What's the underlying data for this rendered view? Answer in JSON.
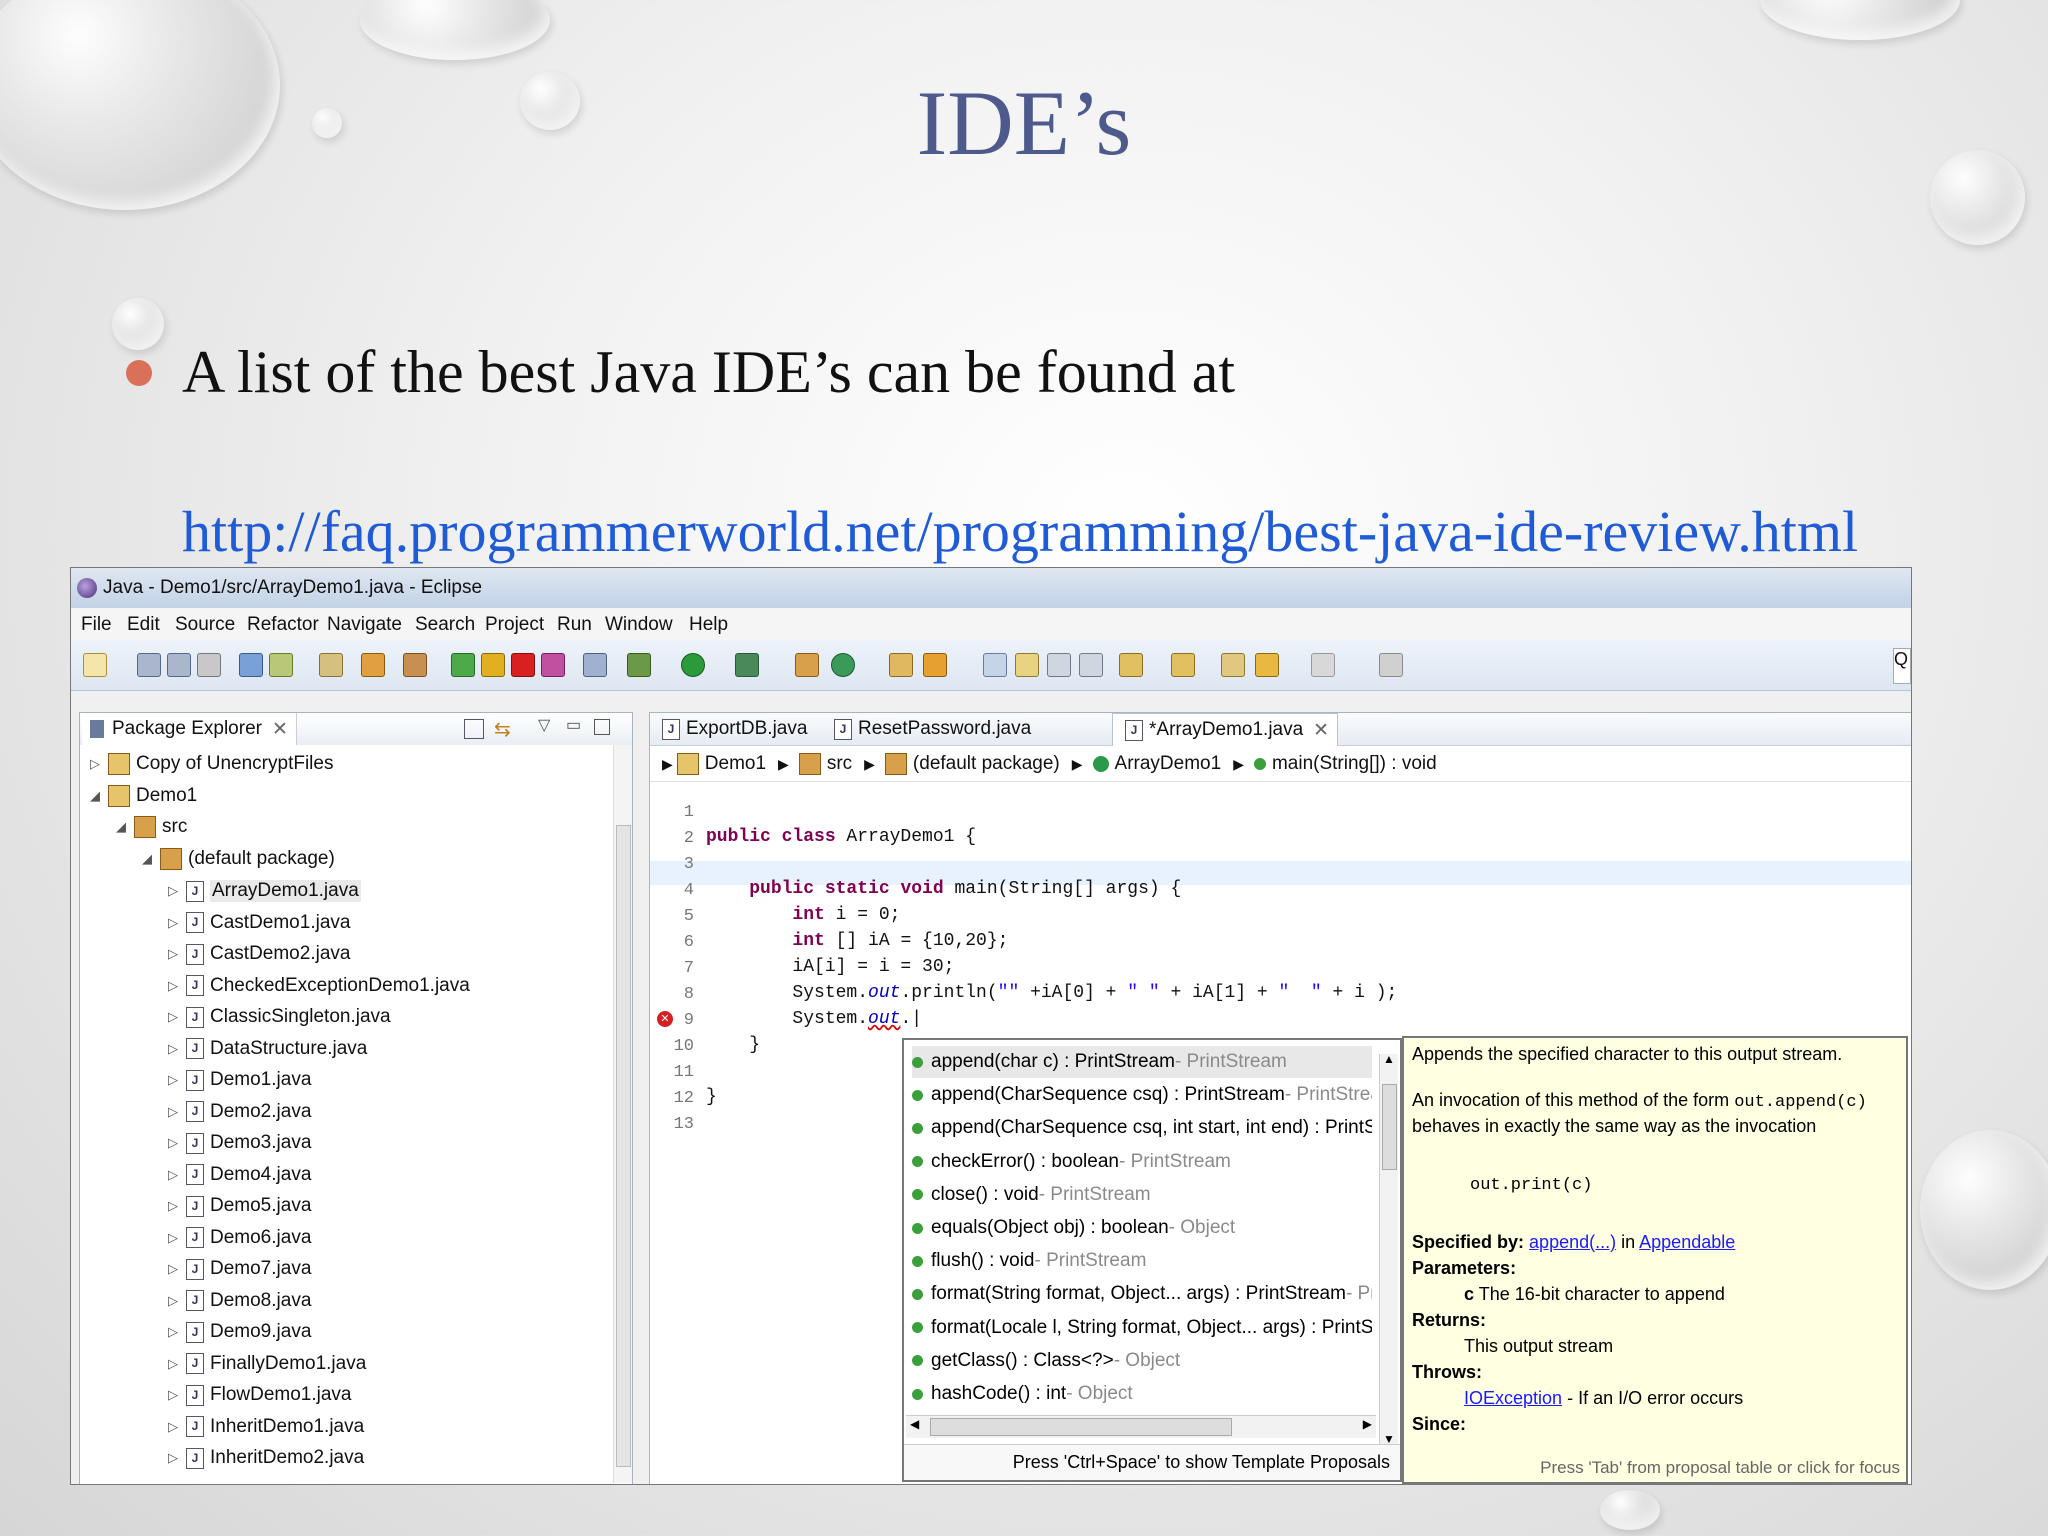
{
  "slide": {
    "title": "IDE’s",
    "bullet": "A list of the best Java IDE’s can be found at",
    "link": "http://faq.programmerworld.net/programming/best-java-ide-review.html"
  },
  "window": {
    "title": "Java - Demo1/src/ArrayDemo1.java - Eclipse",
    "menu": [
      "File",
      "Edit",
      "Source",
      "Refactor",
      "Navigate",
      "Search",
      "Project",
      "Run",
      "Window",
      "Help"
    ],
    "quick_access": "Q"
  },
  "package_explorer": {
    "tab_label": "Package Explorer",
    "tree": {
      "copy_project": "Copy of UnencryptFiles",
      "project": "Demo1",
      "src": "src",
      "package": "(default package)",
      "files": [
        "ArrayDemo1.java",
        "CastDemo1.java",
        "CastDemo2.java",
        "CheckedExceptionDemo1.java",
        "ClassicSingleton.java",
        "DataStructure.java",
        "Demo1.java",
        "Demo2.java",
        "Demo3.java",
        "Demo4.java",
        "Demo5.java",
        "Demo6.java",
        "Demo7.java",
        "Demo8.java",
        "Demo9.java",
        "FinallyDemo1.java",
        "FlowDemo1.java",
        "InheritDemo1.java",
        "InheritDemo2.java"
      ]
    }
  },
  "editor": {
    "tabs": [
      "ExportDB.java",
      "ResetPassword.java",
      "*ArrayDemo1.java"
    ],
    "breadcrumb": [
      "Demo1",
      "src",
      "(default package)",
      "ArrayDemo1",
      "main(String[]) : void"
    ],
    "line_numbers": [
      "1",
      "2",
      "3",
      "4",
      "5",
      "6",
      "7",
      "8",
      "9",
      "10",
      "11",
      "12",
      "13"
    ]
  },
  "content_assist": {
    "proposals": [
      {
        "sig": "append(char c) : PrintStream",
        "owner": " - PrintStream"
      },
      {
        "sig": "append(CharSequence csq) : PrintStream",
        "owner": " - PrintStream"
      },
      {
        "sig": "append(CharSequence csq, int start, int end) : PrintStream",
        "owner": ""
      },
      {
        "sig": "checkError() : boolean",
        "owner": " - PrintStream"
      },
      {
        "sig": "close() : void",
        "owner": " - PrintStream"
      },
      {
        "sig": "equals(Object obj) : boolean",
        "owner": " - Object"
      },
      {
        "sig": "flush() : void",
        "owner": " - PrintStream"
      },
      {
        "sig": "format(String format, Object... args) : PrintStream",
        "owner": " - PrintS"
      },
      {
        "sig": "format(Locale l, String format, Object... args) : PrintStream",
        "owner": ""
      },
      {
        "sig": "getClass() : Class<?>",
        "owner": " - Object"
      },
      {
        "sig": "hashCode() : int",
        "owner": " - Object"
      }
    ],
    "footer": "Press 'Ctrl+Space' to show Template Proposals"
  },
  "javadoc": {
    "summary": "Appends the specified character to this output stream.",
    "invocation_1": "An invocation of this method of the form",
    "code_1": "out.append(c)",
    "invocation_2": "behaves in exactly the same way as the invocation",
    "code_2": "out.print(c)",
    "specified_by_label": "Specified by:",
    "specified_by_link": "append(...)",
    "specified_by_in": "in",
    "specified_by_iface": "Appendable",
    "parameters_label": "Parameters:",
    "param_name": "c",
    "param_desc": "The 16-bit character to append",
    "returns_label": "Returns:",
    "returns_desc": "This output stream",
    "throws_label": "Throws:",
    "throws_link": "IOException",
    "throws_desc": "- If an I/O error occurs",
    "since_label": "Since:",
    "footer": "Press 'Tab' from proposal table or click for focus"
  }
}
